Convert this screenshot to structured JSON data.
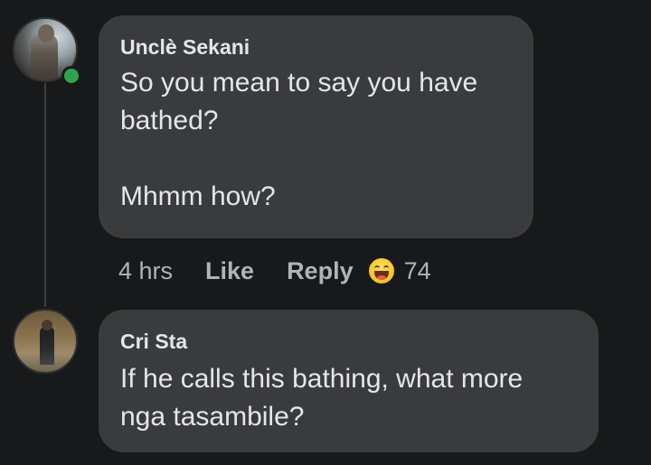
{
  "comments": [
    {
      "author": "Unclè Sekani",
      "text": "So you mean to say you have\nbathed?\n\nMhmm how?",
      "online": true,
      "time": "4 hrs",
      "like_label": "Like",
      "reply_label": "Reply",
      "reaction": {
        "icon": "haha-reaction-icon",
        "count": "74"
      }
    },
    {
      "author": "Cri Sta",
      "text": "If he calls this bathing, what more\nnga tasambile?"
    }
  ],
  "colors": {
    "background": "#18191a",
    "bubble": "#3a3b3c",
    "primary_text": "#e4e6eb",
    "secondary_text": "#b0b3b8",
    "online": "#31a24c"
  }
}
